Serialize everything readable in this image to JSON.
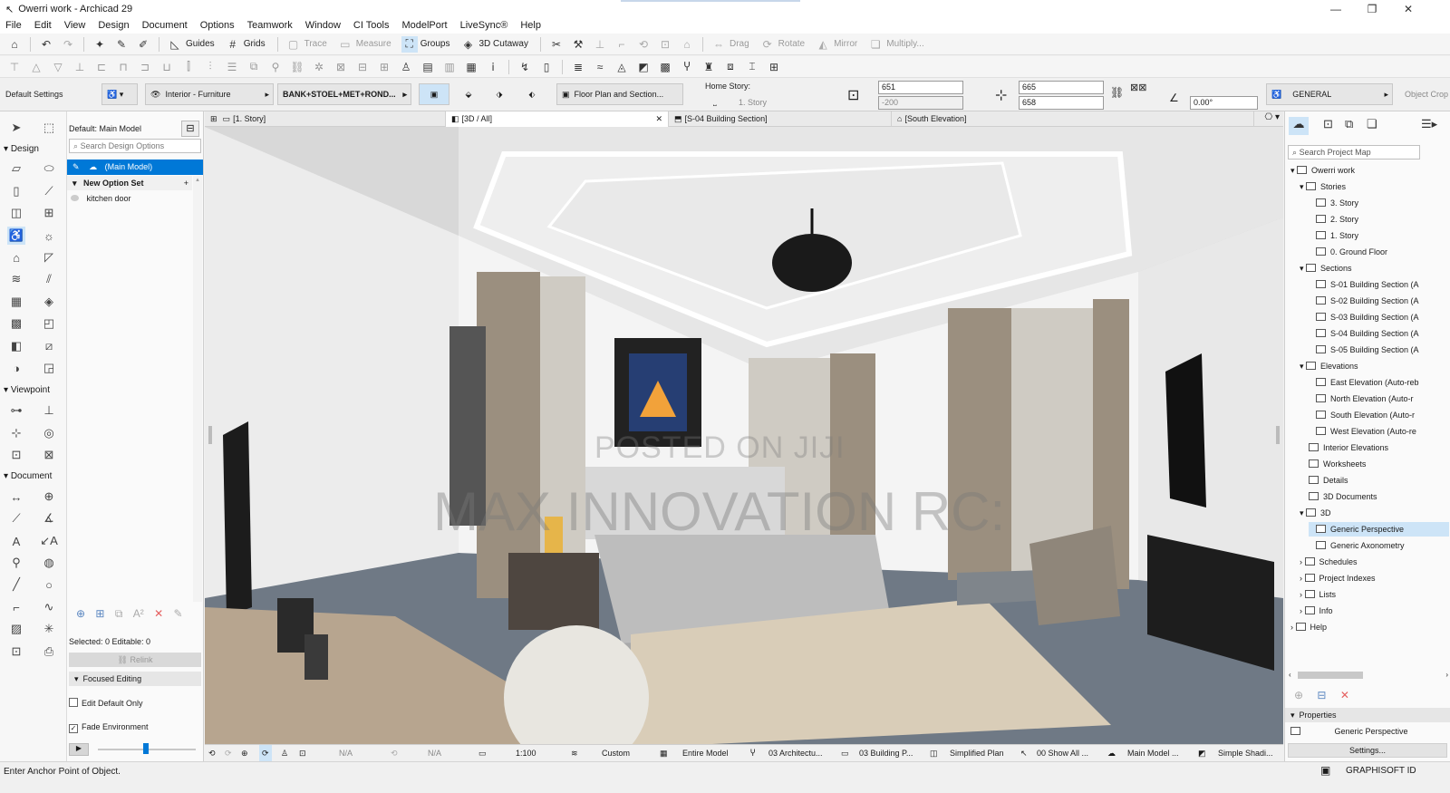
{
  "app": {
    "window_title": "Owerri work - Archicad 29"
  },
  "menu": [
    "File",
    "Edit",
    "View",
    "Design",
    "Document",
    "Options",
    "Teamwork",
    "Window",
    "CI Tools",
    "ModelPort",
    "LiveSync®",
    "Help"
  ],
  "toolbar": {
    "guides": "Guides",
    "grids": "Grids",
    "trace": "Trace",
    "measure": "Measure",
    "groups": "Groups",
    "cutaway": "3D Cutaway",
    "drag": "Drag",
    "rotate": "Rotate",
    "mirror": "Mirror",
    "multiply": "Multiply..."
  },
  "infobox": {
    "default_settings": "Default Settings",
    "layer": "Interior - Furniture",
    "material": "BANK+STOEL+MET+ROND...",
    "floor_plan": "Floor Plan and Section...",
    "home_story_label": "Home Story:",
    "home_story": "1. Story",
    "field_651": "651",
    "field_minus200": "-200",
    "field_665": "665",
    "field_658": "658",
    "angle": "0.00°",
    "general": "GENERAL",
    "object_crop": "Object Crop"
  },
  "tabs": [
    {
      "label": "[1. Story]"
    },
    {
      "label": "[3D / All]"
    },
    {
      "label": "[S-04 Building Section]"
    },
    {
      "label": "[South Elevation]"
    }
  ],
  "toolbox": {
    "design": "Design",
    "viewpoint": "Viewpoint",
    "document": "Document"
  },
  "design_options": {
    "header": "Default: Main Model",
    "search_placeholder": "Search Design Options",
    "main_model": "(Main Model)",
    "option_set": "New Option Set",
    "kitchen_door": "kitchen door",
    "selected": "Selected: 0 Editable: 0",
    "relink": "Relink",
    "focused": "Focused Editing",
    "edit_default": "Edit Default Only",
    "fade_env": "Fade Environment"
  },
  "watermark": {
    "line1": "POSTED ON JIJI",
    "line2": "MAX INNOVATION RC:"
  },
  "project_map": {
    "search_placeholder": "Search Project Map",
    "items": [
      {
        "label": "Owerri work"
      },
      {
        "label": "Stories"
      },
      {
        "label": "3. Story"
      },
      {
        "label": "2. Story"
      },
      {
        "label": "1. Story"
      },
      {
        "label": "0. Ground Floor"
      },
      {
        "label": "Sections"
      },
      {
        "label": "S-01 Building Section (A"
      },
      {
        "label": "S-02 Building Section (A"
      },
      {
        "label": "S-03 Building Section (A"
      },
      {
        "label": "S-04 Building Section (A"
      },
      {
        "label": "S-05 Building Section (A"
      },
      {
        "label": "Elevations"
      },
      {
        "label": "East Elevation (Auto-reb"
      },
      {
        "label": "North Elevation (Auto-r"
      },
      {
        "label": "South Elevation (Auto-r"
      },
      {
        "label": "West Elevation (Auto-re"
      },
      {
        "label": "Interior Elevations"
      },
      {
        "label": "Worksheets"
      },
      {
        "label": "Details"
      },
      {
        "label": "3D Documents"
      },
      {
        "label": "3D"
      },
      {
        "label": "Generic Perspective"
      },
      {
        "label": "Generic Axonometry"
      },
      {
        "label": "Schedules"
      },
      {
        "label": "Project Indexes"
      },
      {
        "label": "Lists"
      },
      {
        "label": "Info"
      },
      {
        "label": "Help"
      }
    ],
    "properties": "Properties",
    "properties_value": "Generic Perspective",
    "settings": "Settings..."
  },
  "viewport_bar": {
    "na1": "N/A",
    "na2": "N/A",
    "scale": "1:100",
    "custom": "Custom",
    "model": "Entire Model",
    "arch": "03 Architectu...",
    "building": "03 Building P...",
    "simplified": "Simplified Plan",
    "showall": "00 Show All ...",
    "main": "Main Model ...",
    "shading": "Simple Shadi..."
  },
  "status": {
    "prompt": "Enter Anchor Point of Object.",
    "graphisoft": "GRAPHISOFT ID"
  },
  "colors": {
    "accent": "#0078d7",
    "selected_row": "#0078d7"
  }
}
